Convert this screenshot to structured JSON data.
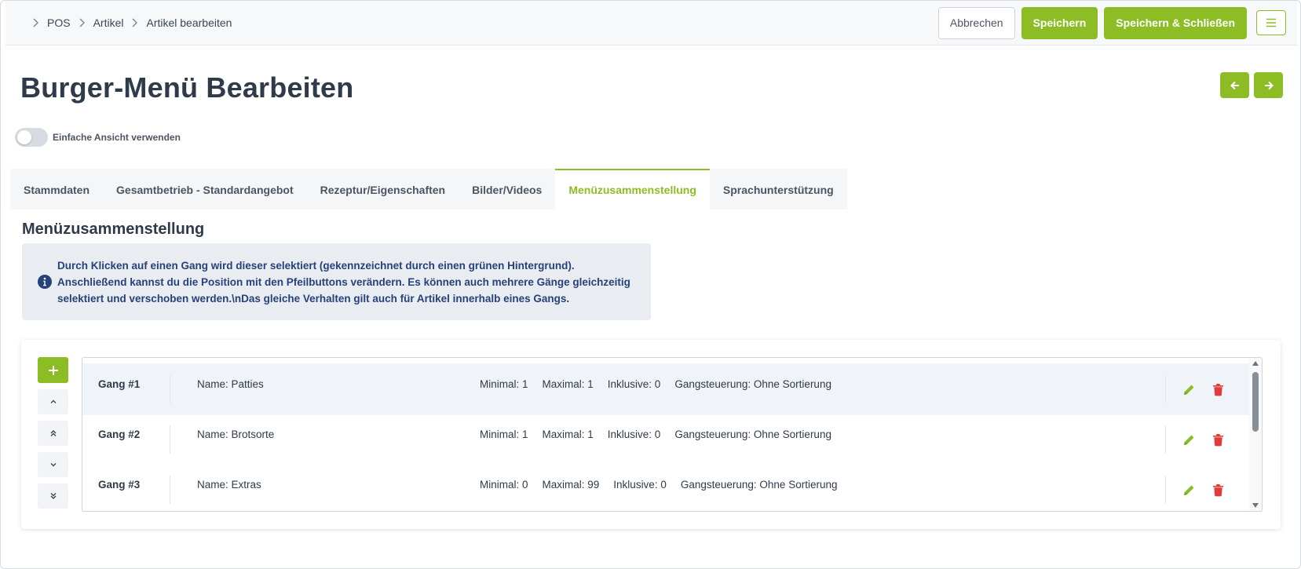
{
  "breadcrumb": {
    "items": [
      "POS",
      "Artikel",
      "Artikel bearbeiten"
    ]
  },
  "toolbar": {
    "cancel_label": "Abbrechen",
    "save_label": "Speichern",
    "save_close_label": "Speichern & Schließen",
    "menu_icon": "hamburger-icon"
  },
  "page": {
    "title": "Burger-Menü Bearbeiten",
    "simple_view_label": "Einfache Ansicht verwenden",
    "simple_view_enabled": false
  },
  "tabs": [
    {
      "label": "Stammdaten",
      "active": false
    },
    {
      "label": "Gesamtbetrieb - Standardangebot",
      "active": false
    },
    {
      "label": "Rezeptur/Eigenschaften",
      "active": false
    },
    {
      "label": "Bilder/Videos",
      "active": false
    },
    {
      "label": "Menüzusammenstellung",
      "active": true
    },
    {
      "label": "Sprachunterstützung",
      "active": false
    }
  ],
  "section": {
    "title": "Menüzusammenstellung",
    "info_text": "Durch Klicken auf einen Gang wird dieser selektiert (gekennzeichnet durch einen grünen Hintergrund).\nAnschließend kannst du die Position mit den Pfeilbuttons verändern. Es können auch mehrere Gänge gleichzeitig\nselektiert und verschoben werden.\\nDas gleiche Verhalten gilt auch für Artikel innerhalb eines Gangs."
  },
  "courses": [
    {
      "label": "Gang #1",
      "name": "Name: Patties",
      "minimal": "Minimal: 1",
      "maximal": "Maximal: 1",
      "inklusive": "Inklusive: 0",
      "steuerung": "Gangsteuerung: Ohne Sortierung",
      "selected": true
    },
    {
      "label": "Gang #2",
      "name": "Name: Brotsorte",
      "minimal": "Minimal: 1",
      "maximal": "Maximal: 1",
      "inklusive": "Inklusive: 0",
      "steuerung": "Gangsteuerung: Ohne Sortierung",
      "selected": false
    },
    {
      "label": "Gang #3",
      "name": "Name: Extras",
      "minimal": "Minimal: 0",
      "maximal": "Maximal: 99",
      "inklusive": "Inklusive: 0",
      "steuerung": "Gangsteuerung: Ohne Sortierung",
      "selected": false
    }
  ],
  "colors": {
    "accent": "#8cbd24",
    "danger": "#e03c3c",
    "info_text": "#26427a",
    "info_bg": "#e9ecf1"
  }
}
